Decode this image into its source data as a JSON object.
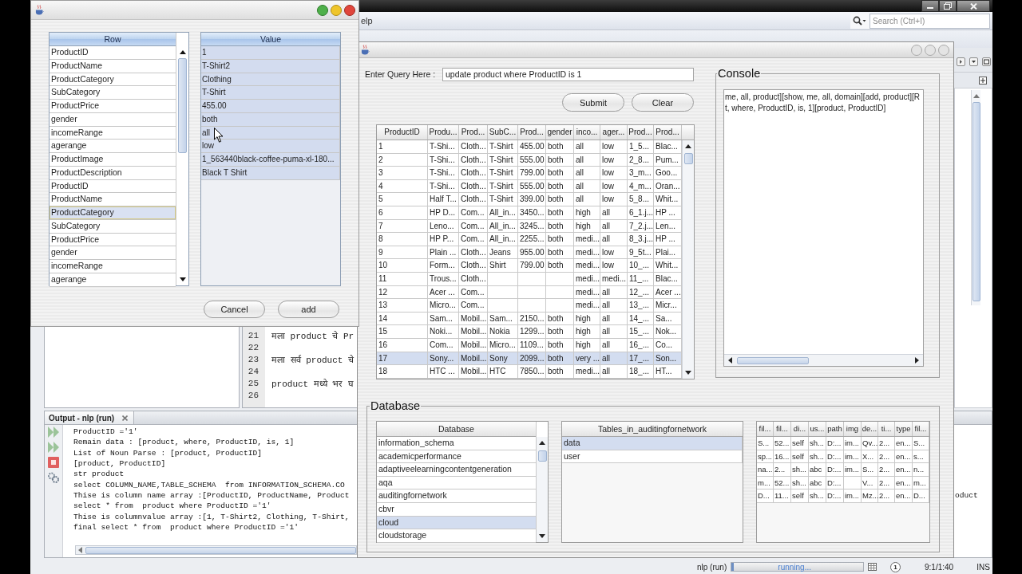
{
  "edit_dialog": {
    "columns": [
      "Row",
      "Value"
    ],
    "rows": [
      {
        "label": "ProductID",
        "selected": false
      },
      {
        "label": "ProductName",
        "selected": false
      },
      {
        "label": "ProductCategory",
        "selected": false
      },
      {
        "label": "SubCategory",
        "selected": false
      },
      {
        "label": "ProductPrice",
        "selected": false
      },
      {
        "label": "gender",
        "selected": false
      },
      {
        "label": "incomeRange",
        "selected": false
      },
      {
        "label": "agerange",
        "selected": false
      },
      {
        "label": "ProductImage",
        "selected": false
      },
      {
        "label": "ProductDescription",
        "selected": false
      },
      {
        "label": "ProductID",
        "selected": false
      },
      {
        "label": "ProductName",
        "selected": false
      },
      {
        "label": "ProductCategory",
        "selected": true
      },
      {
        "label": "SubCategory",
        "selected": false
      },
      {
        "label": "ProductPrice",
        "selected": false
      },
      {
        "label": "gender",
        "selected": false
      },
      {
        "label": "incomeRange",
        "selected": false
      },
      {
        "label": "agerange",
        "selected": false
      }
    ],
    "values": [
      {
        "text": "1",
        "selected": true
      },
      {
        "text": "T-Shirt2",
        "selected": true
      },
      {
        "text": "Clothing",
        "selected": true
      },
      {
        "text": "T-Shirt",
        "selected": true
      },
      {
        "text": "455.00",
        "selected": true
      },
      {
        "text": "both",
        "selected": true
      },
      {
        "text": "all",
        "selected": true
      },
      {
        "text": "low",
        "selected": true
      },
      {
        "text": "1_563440black-coffee-puma-xl-180...",
        "selected": true
      },
      {
        "text": "Black T Shirt",
        "selected": true
      }
    ],
    "buttons": [
      "Cancel",
      "add"
    ]
  },
  "ide": {
    "menu_fragment": "elp",
    "search": {
      "placeholder": "Search (Ctrl+I)"
    },
    "editor": {
      "lines": [
        {
          "number": "21",
          "text": "मला product चे Pr"
        },
        {
          "number": "22"
        },
        {
          "number": "23",
          "text": "मला सर्व product चे"
        },
        {
          "number": "24"
        },
        {
          "number": "25",
          "text": "product मध्ये भर घ"
        },
        {
          "number": "26"
        }
      ]
    },
    "output": {
      "tab": "Output - nlp (run)",
      "lines": [
        "ProductID ='1'",
        "Remain data : [product, where, ProductID, is, 1]",
        "List of Noun Parse : [product, ProductID]",
        "[product, ProductID]",
        "str product",
        "select COLUMN_NAME,TABLE_SCHEMA  from INFORMATION_SCHEMA.CO",
        "Thise is column name array :[ProductID, ProductName, Product",
        "select * from  product where ProductID ='1'",
        "Thise is columnvalue array :[1, T-Shirt2, Clothing, T-Shirt,",
        "final select * from  product where ProductID ='1'"
      ],
      "overflow_fragment": "oduct"
    },
    "status_bar": {
      "task": "nlp (run)",
      "progress": {
        "label": "running...",
        "level": 0.02
      },
      "notifications": "1",
      "position": "9:1/1:40",
      "mode": "INS"
    }
  },
  "query_window": {
    "query_label": "Enter Query Here :",
    "query": {
      "value": "update product where ProductID is 1"
    },
    "buttons": [
      "Submit",
      "Clear"
    ],
    "results": {
      "columns": [
        "ProductID",
        "Produ...",
        "Prod...",
        "SubC...",
        "Prod...",
        "gender",
        "inco...",
        "ager...",
        "Prod...",
        "Prod..."
      ],
      "rows": [
        {
          "cells": [
            "1",
            "T-Shi...",
            "Cloth...",
            "T-Shirt",
            "455.00",
            "both",
            "all",
            "low",
            "1_5...",
            "Blac..."
          ],
          "selected": false
        },
        {
          "cells": [
            "2",
            "T-Shi...",
            "Cloth...",
            "T-Shirt",
            "555.00",
            "both",
            "all",
            "low",
            "2_8...",
            "Pum..."
          ],
          "selected": false
        },
        {
          "cells": [
            "3",
            "T-Shi...",
            "Cloth...",
            "T-Shirt",
            "799.00",
            "both",
            "all",
            "low",
            "3_m...",
            "Goo..."
          ],
          "selected": false
        },
        {
          "cells": [
            "4",
            "T-Shi...",
            "Cloth...",
            "T-Shirt",
            "555.00",
            "both",
            "all",
            "low",
            "4_m...",
            "Oran..."
          ],
          "selected": false
        },
        {
          "cells": [
            "5",
            "Half T...",
            "Cloth...",
            "T-Shirt",
            "399.00",
            "both",
            "all",
            "low",
            "5_8...",
            "Whit..."
          ],
          "selected": false
        },
        {
          "cells": [
            "6",
            "HP D...",
            "Com...",
            "All_in...",
            "3450...",
            "both",
            "high",
            "all",
            "6_1.j...",
            "HP ..."
          ],
          "selected": false
        },
        {
          "cells": [
            "7",
            "Leno...",
            "Com...",
            "All_in...",
            "3245...",
            "both",
            "high",
            "all",
            "7_2.j...",
            "Len..."
          ],
          "selected": false
        },
        {
          "cells": [
            "8",
            "HP P...",
            "Com...",
            "All_in...",
            "2255...",
            "both",
            "medi...",
            "all",
            "8_3.j...",
            "HP ..."
          ],
          "selected": false
        },
        {
          "cells": [
            "9",
            "Plain ...",
            "Cloth...",
            "Jeans",
            "955.00",
            "both",
            "medi...",
            "low",
            "9_5t...",
            "Plai..."
          ],
          "selected": false
        },
        {
          "cells": [
            "10",
            "Form...",
            "Cloth...",
            "Shirt",
            "799.00",
            "both",
            "medi...",
            "low",
            "10_...",
            "Whit..."
          ],
          "selected": false
        },
        {
          "cells": [
            "11",
            "Trous...",
            "Cloth...",
            null,
            null,
            null,
            "medi...",
            "medi...",
            "11_...",
            "Blac..."
          ],
          "selected": false
        },
        {
          "cells": [
            "12",
            "Acer ...",
            "Com...",
            null,
            null,
            null,
            "medi...",
            "all",
            "12_...",
            "Acer ..."
          ],
          "selected": false
        },
        {
          "cells": [
            "13",
            "Micro...",
            "Com...",
            null,
            null,
            null,
            "medi...",
            "all",
            "13_...",
            "Micr..."
          ],
          "selected": false
        },
        {
          "cells": [
            "14",
            "Sam...",
            "Mobil...",
            "Sam...",
            "2150...",
            "both",
            "high",
            "all",
            "14_...",
            "Sa..."
          ],
          "selected": false
        },
        {
          "cells": [
            "15",
            "Noki...",
            "Mobil...",
            "Nokia",
            "1299...",
            "both",
            "high",
            "all",
            "15_...",
            "Nok..."
          ],
          "selected": false
        },
        {
          "cells": [
            "16",
            "Com...",
            "Mobil...",
            "Micro...",
            "1109...",
            "both",
            "high",
            "all",
            "16_...",
            "Co..."
          ],
          "selected": false
        },
        {
          "cells": [
            "17",
            "Sony...",
            "Mobil...",
            "Sony",
            "2099...",
            "both",
            "very ...",
            "all",
            "17_...",
            "Son..."
          ],
          "selected": true
        },
        {
          "cells": [
            "18",
            "HTC ...",
            "Mobil...",
            "HTC",
            "7850...",
            "both",
            "medi...",
            "all",
            "18_...",
            "HT..."
          ],
          "selected": false
        }
      ]
    },
    "console": {
      "title": "Console",
      "lines": [
        "me, all, product][show, me, all, domain][add, product][R",
        "t, where, ProductID, is, 1][product, ProductID]"
      ]
    },
    "database": {
      "title": "Database",
      "databases": {
        "header": "Database",
        "items": [
          {
            "name": "information_schema",
            "selected": false
          },
          {
            "name": "academicperformance",
            "selected": false
          },
          {
            "name": "adaptiveelearningcontentgeneration",
            "selected": false
          },
          {
            "name": "aqa",
            "selected": false
          },
          {
            "name": "auditingfornetwork",
            "selected": false
          },
          {
            "name": "cbvr",
            "selected": false
          },
          {
            "name": "cloud",
            "selected": true
          },
          {
            "name": "cloudstorage",
            "selected": false
          }
        ]
      },
      "tables": {
        "header": "Tables_in_auditingfornetwork",
        "items": [
          {
            "name": "data",
            "selected": true
          },
          {
            "name": "user",
            "selected": false
          }
        ]
      },
      "records": {
        "columns": [
          "fil...",
          "fil...",
          "di...",
          "us...",
          "path",
          "img",
          "de...",
          "ti...",
          "type",
          "fil..."
        ],
        "rows": [
          [
            "S...",
            "52...",
            "self",
            "sh...",
            "D:...",
            "im...",
            "Qv...",
            "2...",
            "en...",
            "S..."
          ],
          [
            "sp...",
            "16...",
            "self",
            "sh...",
            "D:...",
            "im...",
            "X...",
            "2...",
            "en...",
            "s..."
          ],
          [
            "na...",
            "2...",
            "sh...",
            "abc",
            "D:...",
            "im...",
            "S...",
            "2...",
            "en...",
            "n..."
          ],
          [
            "m...",
            "52...",
            "sh...",
            "abc",
            "D:...",
            null,
            "V...",
            "2...",
            "en...",
            "m..."
          ],
          [
            "D...",
            "11...",
            "self",
            "sh...",
            "D:...",
            "im...",
            "Mz...",
            "2...",
            "en...",
            "D..."
          ]
        ]
      }
    }
  }
}
